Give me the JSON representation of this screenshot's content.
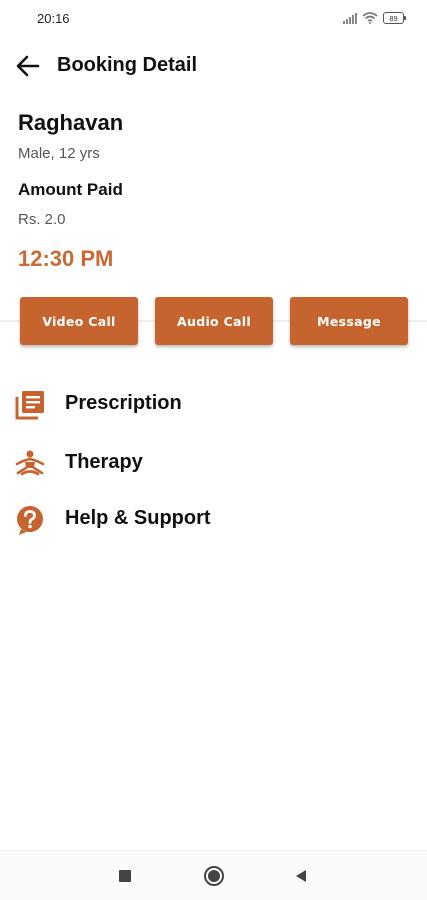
{
  "status_bar": {
    "time": "20:16",
    "battery": "89"
  },
  "header": {
    "title": "Booking Detail"
  },
  "patient": {
    "name": "Raghavan",
    "details": "Male, 12 yrs",
    "amount_label": "Amount Paid",
    "amount_value": "Rs. 2.0",
    "time": "12:30 PM"
  },
  "actions": {
    "video_call": "Video Call",
    "audio_call": "Audio Call",
    "message": "Message"
  },
  "menu": [
    {
      "label": "Prescription",
      "icon": "prescription-icon"
    },
    {
      "label": "Therapy",
      "icon": "meditation-icon"
    },
    {
      "label": "Help & Support",
      "icon": "help-icon"
    }
  ],
  "theme": {
    "accent": "#c5642f",
    "time_color": "#c96a36"
  }
}
